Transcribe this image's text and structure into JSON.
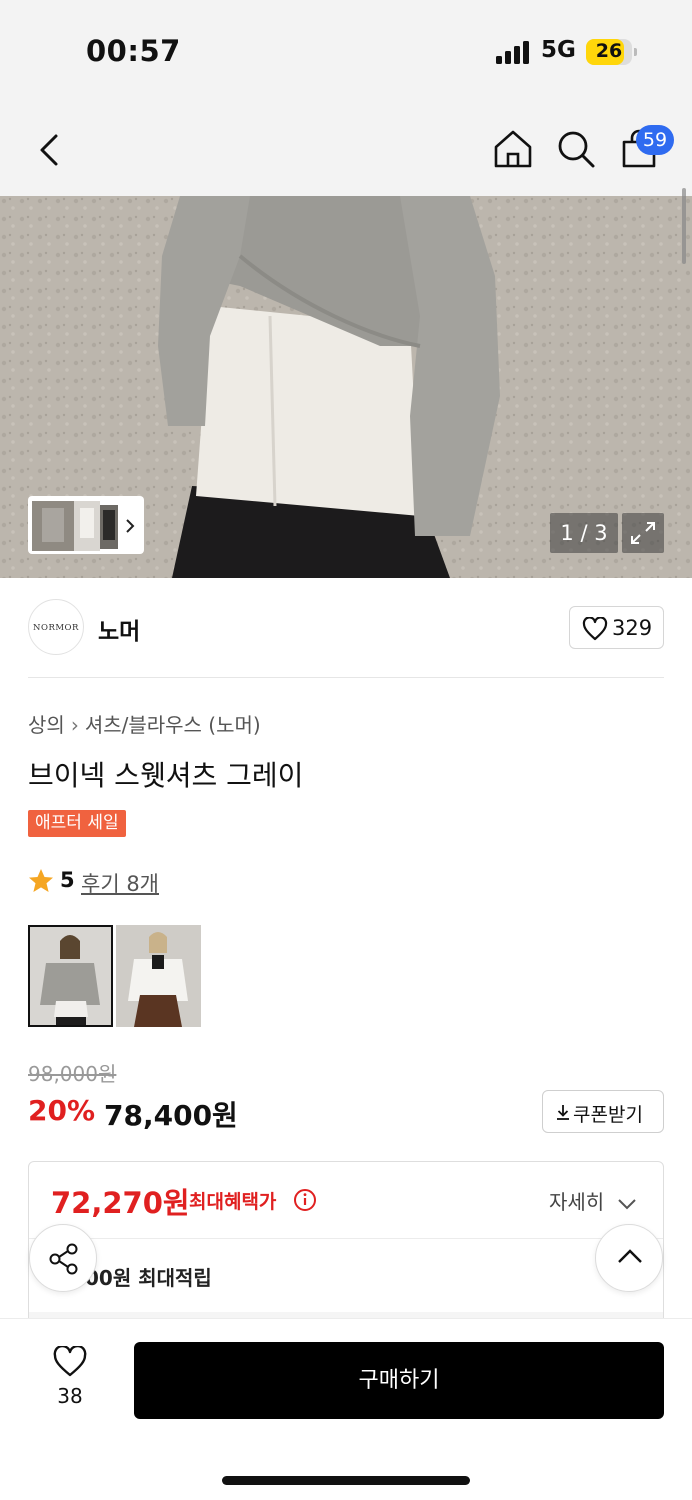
{
  "status_bar": {
    "time": "00:57",
    "network": "5G",
    "battery": "26"
  },
  "nav": {
    "back_icon": "chevron-left-icon",
    "home_icon": "home-icon",
    "search_icon": "search-icon",
    "cart_icon": "shopping-bag-icon",
    "cart_badge": "59"
  },
  "gallery": {
    "pager": "1 / 3",
    "expand_icon": "expand-icon"
  },
  "brand": {
    "logo_text": "NORMOR",
    "name": "노머",
    "likes": "329"
  },
  "product": {
    "breadcrumb": [
      "상의",
      "셔츠/블라우스 (노머)"
    ],
    "title": "브이넥 스웻셔츠 그레이",
    "tag": "애프터 세일",
    "rating": "5",
    "reviews": "후기 8개",
    "options": [
      "grey-sweatshirt-look",
      "white-shirt-look"
    ]
  },
  "price": {
    "original": "98,000원",
    "discount": "20%",
    "sale": "78,400원",
    "coupon_label": "쿠폰받기"
  },
  "benefit": {
    "max_price": "72,270원",
    "max_label": "최대혜택가",
    "detail_label": "자세히",
    "points": "00원 최대적립"
  },
  "bottom": {
    "wish_count": "38",
    "buy_label": "구매하기"
  },
  "colors": {
    "accent_red": "#e02020",
    "tag_orange": "#f0623f",
    "badge_blue": "#2f6bf0",
    "star": "#f5a623"
  }
}
